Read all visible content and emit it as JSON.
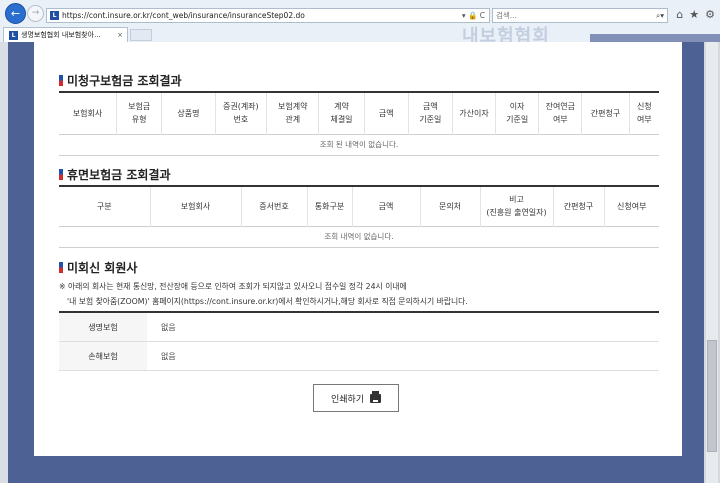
{
  "browser": {
    "url": "https://cont.insure.or.kr/cont_web/insurance/insuranceStep02.do",
    "url_controls": "▾ 🔒 C",
    "search_placeholder": "검색...",
    "search_icon_text": "⌕▾",
    "tab_title": "생명보험협회 내보험찾아...",
    "tab_close": "×",
    "bg_text": "내보험협회"
  },
  "unclaimed": {
    "title": "미청구보험금 조회결과",
    "headers": [
      [
        "보험회사"
      ],
      [
        "보험금",
        "유형"
      ],
      [
        "상품명"
      ],
      [
        "증권(계좌)",
        "번호"
      ],
      [
        "보험계약",
        "관계"
      ],
      [
        "계약",
        "체결일"
      ],
      [
        "금액"
      ],
      [
        "금액",
        "기준일"
      ],
      [
        "가산이자"
      ],
      [
        "이자",
        "기준일"
      ],
      [
        "잔여연금",
        "여부"
      ],
      [
        "간편청구"
      ],
      [
        "신청",
        "여부"
      ]
    ],
    "empty_message": "조회 된 내역이 없습니다."
  },
  "dormant": {
    "title": "휴면보험금 조회결과",
    "headers": [
      [
        "구분"
      ],
      [
        "보험회사"
      ],
      [
        "증서번호"
      ],
      [
        "통화구분"
      ],
      [
        "금액"
      ],
      [
        "문의처"
      ],
      [
        "비고",
        "(진흥원 출연일자)"
      ],
      [
        "간편청구"
      ],
      [
        "신청여부"
      ]
    ],
    "empty_message": "조회 내역이 없습니다."
  },
  "non_reply": {
    "title": "미회신 회원사",
    "note_line1": "※ 아래의 회사는 현재 통신망, 전산장애 등으로 인하여 조회가 되지않고 있사오니 접수일 정각 24시 이내에",
    "note_line2": "'내 보험 찾아줌(ZOOM)' 홈페이지(https://cont.insure.or.kr)에서 확인하시거나,해당 회사로 직접 문의하시기 바랍니다.",
    "rows": [
      {
        "label": "생명보험",
        "value": "없음"
      },
      {
        "label": "손해보험",
        "value": "없음"
      }
    ]
  },
  "print_label": "인쇄하기"
}
